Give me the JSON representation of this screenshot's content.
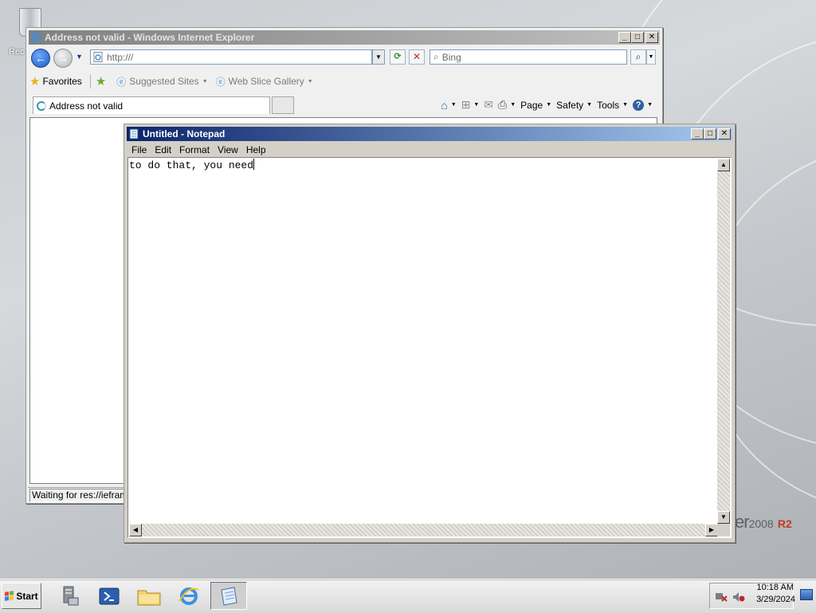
{
  "desktop": {
    "recycle_label": "Rec",
    "branding": {
      "text": "er",
      "version": "2008",
      "edition": "R2"
    }
  },
  "ie": {
    "title": "Address not valid - Windows Internet Explorer",
    "address": "http:///",
    "search_placeholder": "Bing",
    "favorites_label": "Favorites",
    "fav_items": [
      "Suggested Sites",
      "Web Slice Gallery"
    ],
    "tab_title": "Address not valid",
    "commands": {
      "page": "Page",
      "safety": "Safety",
      "tools": "Tools"
    },
    "status": "Waiting for res://ieframe"
  },
  "notepad": {
    "title": "Untitled - Notepad",
    "menus": [
      "File",
      "Edit",
      "Format",
      "View",
      "Help"
    ],
    "text": "to do that, you need"
  },
  "taskbar": {
    "start_label": "Start",
    "time": "10:18 AM",
    "date": "3/29/2024"
  },
  "colors": {
    "titlebar_active": "#0a246a",
    "titlebar_inactive": "#808080",
    "window_face": "#d4d0c8"
  }
}
